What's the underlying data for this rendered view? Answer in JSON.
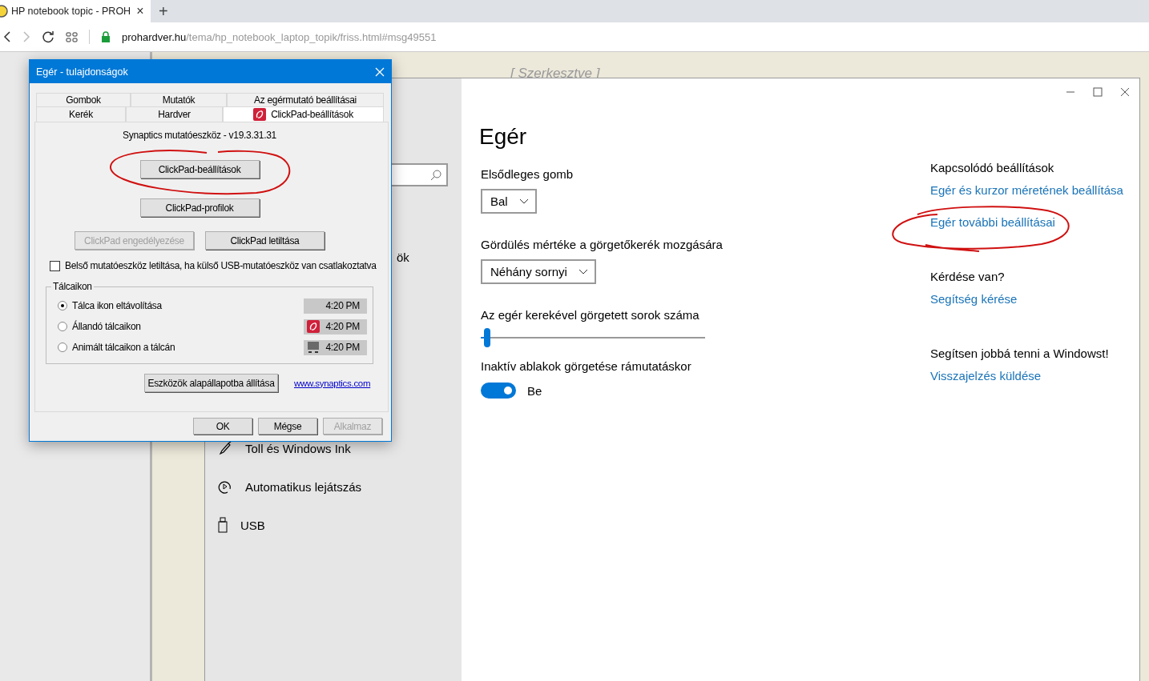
{
  "browser": {
    "tab_title": "HP notebook topic - PROH",
    "tab_close": "×",
    "new_tab": "+",
    "url_host": "prohardver.hu",
    "url_path": "/tema/hp_notebook_laptop_topik/friss.html#msg49551"
  },
  "page": {
    "edited_note": "[ Szerkesztve ]"
  },
  "settings": {
    "hidden_fragment": "ök",
    "nav_items": [
      {
        "label": "Toll és Windows Ink",
        "kind": "pen"
      },
      {
        "label": "Automatikus lejátszás",
        "kind": "autoplay"
      },
      {
        "label": "USB",
        "kind": "usb"
      }
    ],
    "title": "Egér",
    "primary_button": {
      "label": "Elsődleges gomb",
      "value": "Bal"
    },
    "scroll_mode": {
      "label": "Gördülés mértéke a görgetőkerék mozgására",
      "value": "Néhány sornyi"
    },
    "scroll_lines": {
      "label": "Az egér kerekével görgetett sorok száma",
      "level": 0.03
    },
    "inactive_scroll": {
      "label": "Inaktív ablakok görgetése rámutatáskor",
      "on": true,
      "state": "Be"
    },
    "related": [
      {
        "kind": "heading",
        "text": "Kapcsolódó beállítások"
      },
      {
        "kind": "link",
        "text": "Egér és kurzor méretének beállítása"
      },
      {
        "kind": "link",
        "text": "Egér további beállításai"
      },
      {
        "kind": "heading",
        "text": "Kérdése van?"
      },
      {
        "kind": "link",
        "text": "Segítség kérése"
      },
      {
        "kind": "heading",
        "text": "Segítsen jobbá tenni a Windowst!"
      },
      {
        "kind": "link",
        "text": "Visszajelzés küldése"
      }
    ]
  },
  "dialog": {
    "title": "Egér - tulajdonságok",
    "tab_rows": [
      [
        {
          "label": "Gombok",
          "selected": false,
          "has_icon": false
        },
        {
          "label": "Mutatók",
          "selected": false,
          "has_icon": false
        },
        {
          "label": "Az egérmutató beállításai",
          "selected": false,
          "has_icon": false
        }
      ],
      [
        {
          "label": "Kerék",
          "selected": false,
          "has_icon": false
        },
        {
          "label": "Hardver",
          "selected": false,
          "has_icon": false
        },
        {
          "label": "ClickPad-beállítások",
          "selected": true,
          "has_icon": true
        }
      ]
    ],
    "version": "Synaptics mutatóeszköz - v19.3.31.31",
    "button_rows": [
      [
        {
          "label": "ClickPad-beállítások",
          "disabled": false
        }
      ],
      [
        {
          "label": "ClickPad-profilok",
          "disabled": false
        }
      ],
      [
        {
          "label": "ClickPad engedélyezése",
          "disabled": true
        },
        {
          "label": "ClickPad letiltása",
          "disabled": false
        }
      ]
    ],
    "checkbox": {
      "label": "Belső mutatóeszköz letiltása, ha külső USB-mutatóeszköz van csatlakoztatva",
      "checked": false
    },
    "group": {
      "title": "Tálcaikon",
      "options": [
        {
          "label": "Tálca ikon eltávolítása",
          "selected": true,
          "time": "4:20 PM",
          "kind": "none"
        },
        {
          "label": "Állandó tálcaikon",
          "selected": false,
          "time": "4:20 PM",
          "kind": "app"
        },
        {
          "label": "Animált tálcaikon a tálcán",
          "selected": false,
          "time": "4:20 PM",
          "kind": "monitor"
        }
      ]
    },
    "reset_button": "Eszközök alapállapotba állítása",
    "link": "www.synaptics.com",
    "footer": [
      {
        "label": "OK",
        "disabled": false
      },
      {
        "label": "Mégse",
        "disabled": false
      },
      {
        "label": "Alkalmaz",
        "disabled": true
      }
    ]
  }
}
